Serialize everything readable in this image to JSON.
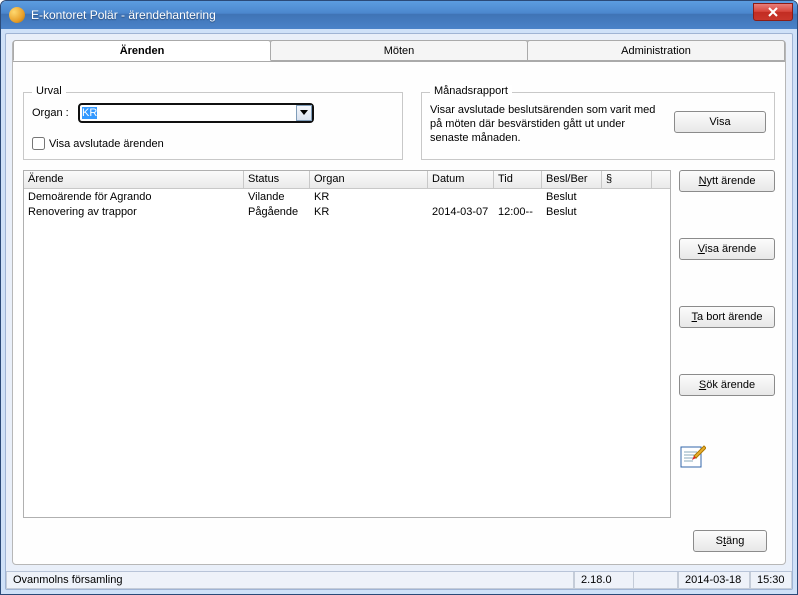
{
  "window": {
    "title": "E-kontoret Polär - ärendehantering"
  },
  "tabs": [
    {
      "label": "Ärenden",
      "active": true
    },
    {
      "label": "Möten",
      "active": false
    },
    {
      "label": "Administration",
      "active": false
    }
  ],
  "urval": {
    "legend": "Urval",
    "organ_label": "Organ :",
    "organ_value": "KR",
    "visa_avslutade_label": "Visa avslutade ärenden",
    "visa_avslutade_checked": false
  },
  "manadsrapport": {
    "legend": "Månadsrapport",
    "text": "Visar avslutade beslutsärenden som varit med på möten där besvärstiden gått ut under senaste månaden.",
    "visa_label": "Visa"
  },
  "table": {
    "headers": {
      "arende": "Ärende",
      "status": "Status",
      "organ": "Organ",
      "datum": "Datum",
      "tid": "Tid",
      "besl_ber": "Besl/Ber",
      "par": "§"
    },
    "rows": [
      {
        "arende": "Demoärende för Agrando",
        "status": "Vilande",
        "organ": "KR",
        "datum": "",
        "tid": "",
        "besl_ber": "Beslut",
        "par": ""
      },
      {
        "arende": "Renovering av trappor",
        "status": "Pågående",
        "organ": "KR",
        "datum": "2014-03-07",
        "tid": "12:00--",
        "besl_ber": "Beslut",
        "par": ""
      }
    ]
  },
  "side_buttons": {
    "nytt": {
      "pre": "",
      "u": "N",
      "post": "ytt ärende"
    },
    "visa": {
      "pre": "",
      "u": "V",
      "post": "isa ärende"
    },
    "tabort": {
      "pre": "",
      "u": "T",
      "post": "a bort ärende"
    },
    "sok": {
      "pre": "",
      "u": "S",
      "post": "ök ärende"
    }
  },
  "bottom": {
    "stang": {
      "pre": "S",
      "u": "t",
      "post": "äng"
    }
  },
  "statusbar": {
    "org": "Ovanmolns församling",
    "version": "2.18.0",
    "date": "2014-03-18",
    "time": "15:30"
  }
}
